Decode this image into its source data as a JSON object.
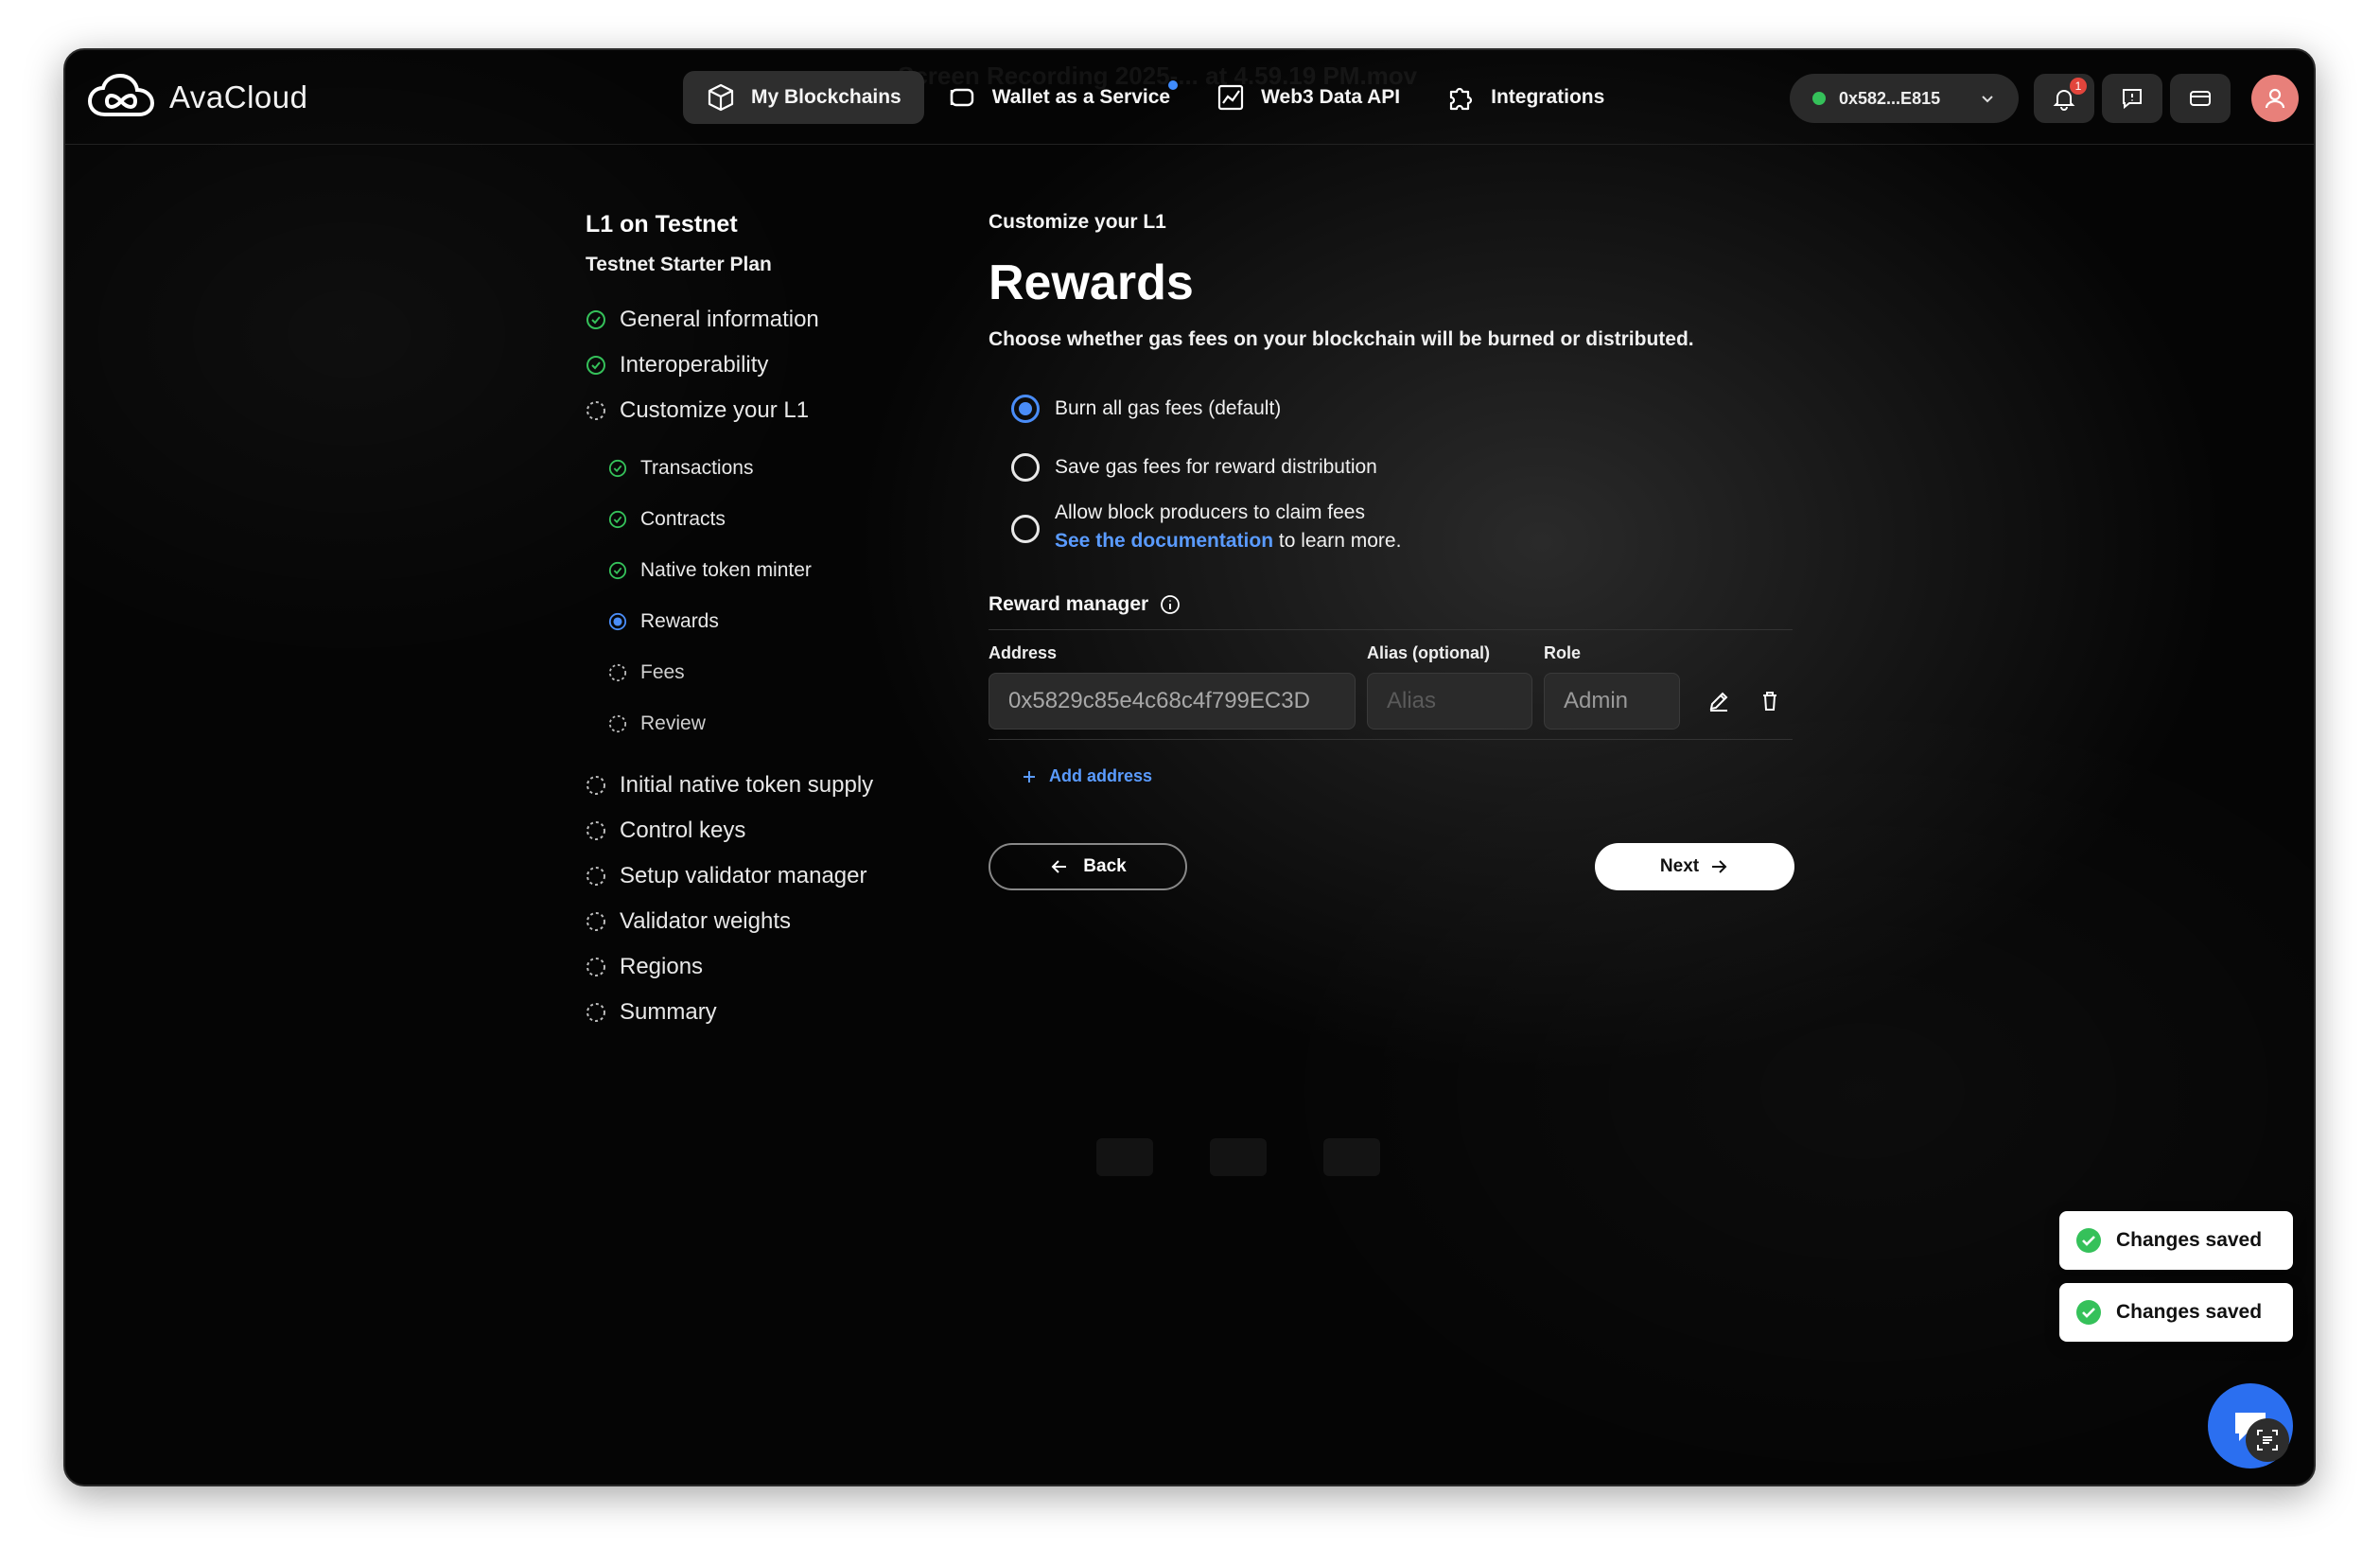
{
  "app": {
    "name": "AvaCloud"
  },
  "ghost_title": "Screen Recording 2025-... at 4.59.19 PM.mov",
  "nav": [
    {
      "label": "My Blockchains",
      "icon": "cube-icon",
      "active": true
    },
    {
      "label": "Wallet as a Service",
      "icon": "wallet-icon",
      "dot": true
    },
    {
      "label": "Web3 Data API",
      "icon": "chart-icon"
    },
    {
      "label": "Integrations",
      "icon": "puzzle-icon"
    }
  ],
  "wallet": {
    "address": "0x582...E815",
    "status_color": "#35c15a"
  },
  "notifications": {
    "count": "1"
  },
  "stepper": {
    "title": "L1 on Testnet",
    "plan": "Testnet Starter Plan",
    "steps_top": [
      {
        "label": "General information",
        "state": "done"
      },
      {
        "label": "Interoperability",
        "state": "done"
      },
      {
        "label": "Customize your L1",
        "state": "pending"
      }
    ],
    "substeps": [
      {
        "label": "Transactions",
        "state": "done"
      },
      {
        "label": "Contracts",
        "state": "done"
      },
      {
        "label": "Native token minter",
        "state": "done"
      },
      {
        "label": "Rewards",
        "state": "current"
      },
      {
        "label": "Fees",
        "state": "pending"
      },
      {
        "label": "Review",
        "state": "pending"
      }
    ],
    "steps_bottom": [
      {
        "label": "Initial native token supply",
        "state": "pending"
      },
      {
        "label": "Control keys",
        "state": "pending"
      },
      {
        "label": "Setup validator manager",
        "state": "pending"
      },
      {
        "label": "Validator weights",
        "state": "pending"
      },
      {
        "label": "Regions",
        "state": "pending"
      },
      {
        "label": "Summary",
        "state": "pending"
      }
    ]
  },
  "main": {
    "eyebrow": "Customize your L1",
    "title": "Rewards",
    "description": "Choose whether gas fees on your blockchain will be burned or distributed.",
    "options": {
      "burn": "Burn all gas fees (default)",
      "save": "Save gas fees for reward distribution",
      "allow": "Allow block producers to claim fees",
      "doc_link": "See the documentation",
      "doc_suffix": " to learn more."
    },
    "reward_manager": {
      "label": "Reward manager",
      "col_address": "Address",
      "col_alias": "Alias (optional)",
      "col_role": "Role",
      "address_value": "0x5829c85e4c68c4f799EC3D",
      "alias_placeholder": "Alias",
      "role_value": "Admin",
      "add_label": "Add address"
    },
    "back_label": "Back",
    "next_label": "Next"
  },
  "toasts": [
    "Changes saved",
    "Changes saved"
  ],
  "colors": {
    "accent": "#4a8df8",
    "success": "#35c15a",
    "link": "#5a9bff"
  }
}
